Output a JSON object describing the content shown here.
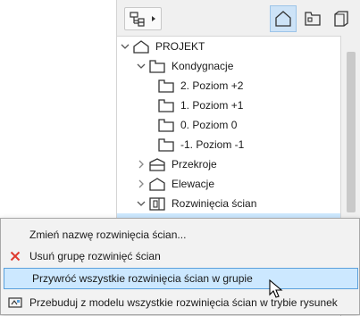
{
  "navigator": {
    "tree": [
      {
        "label": "PROJEKT",
        "level": 0,
        "expanded": true,
        "icon": "project-icon"
      },
      {
        "label": "Kondygnacje",
        "level": 1,
        "expanded": true,
        "icon": "stories-folder-icon"
      },
      {
        "label": "2. Poziom +2",
        "level": 2,
        "icon": "story-icon"
      },
      {
        "label": "1. Poziom +1",
        "level": 2,
        "icon": "story-icon"
      },
      {
        "label": "0. Poziom 0",
        "level": 2,
        "icon": "story-icon"
      },
      {
        "label": "-1. Poziom -1",
        "level": 2,
        "icon": "story-icon"
      },
      {
        "label": "Przekroje",
        "level": 1,
        "expanded": false,
        "icon": "section-icon"
      },
      {
        "label": "Elewacje",
        "level": 1,
        "expanded": false,
        "icon": "elevation-icon"
      },
      {
        "label": "Rozwinięcia ścian",
        "level": 1,
        "expanded": true,
        "icon": "interior-elevation-icon"
      }
    ]
  },
  "context_menu": {
    "items": [
      {
        "label": "Zmień nazwę rozwinięcia ścian...",
        "icon": ""
      },
      {
        "label": "Usuń grupę rozwinięć ścian",
        "icon": "delete-x-icon"
      },
      {
        "label": "Przywróć wszystkie rozwinięcia ścian w grupie",
        "icon": "",
        "hovered": true
      },
      {
        "label": "Przebuduj z modelu wszystkie rozwinięcia ścian w trybie rysunek",
        "icon": "rebuild-icon"
      }
    ]
  },
  "colors": {
    "accent": "#cde3f7",
    "hover": "#cce8ff",
    "delete": "#e03a2f"
  }
}
